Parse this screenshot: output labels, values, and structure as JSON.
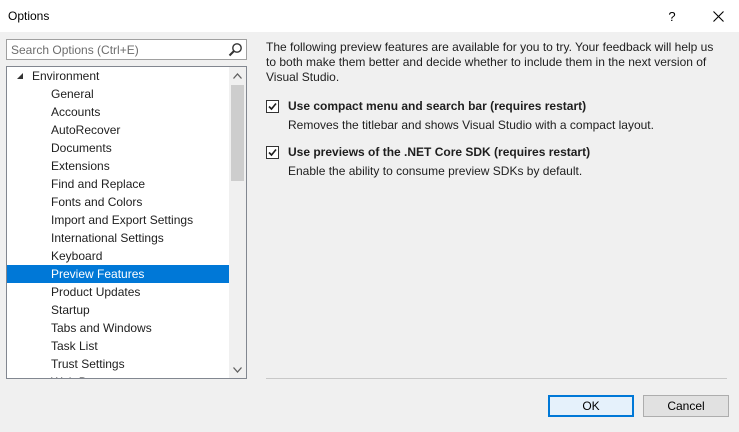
{
  "window": {
    "title": "Options",
    "help_label": "?",
    "close_label": "✕"
  },
  "search": {
    "placeholder": "Search Options (Ctrl+E)",
    "value": ""
  },
  "tree": {
    "root": {
      "label": "Environment",
      "expander": "◢"
    },
    "items": [
      {
        "label": "General"
      },
      {
        "label": "Accounts"
      },
      {
        "label": "AutoRecover"
      },
      {
        "label": "Documents"
      },
      {
        "label": "Extensions"
      },
      {
        "label": "Find and Replace"
      },
      {
        "label": "Fonts and Colors"
      },
      {
        "label": "Import and Export Settings"
      },
      {
        "label": "International Settings"
      },
      {
        "label": "Keyboard"
      },
      {
        "label": "Preview Features",
        "selected": true
      },
      {
        "label": "Product Updates"
      },
      {
        "label": "Startup"
      },
      {
        "label": "Tabs and Windows"
      },
      {
        "label": "Task List"
      },
      {
        "label": "Trust Settings"
      },
      {
        "label": "Web Browser"
      }
    ],
    "scroll_up": "▲",
    "scroll_down": "▼"
  },
  "main": {
    "description": "The following preview features are available for you to try. Your feedback will help us to both make them better and decide whether to include them in the next version of Visual Studio.",
    "options": [
      {
        "label": "Use compact menu and search bar (requires restart)",
        "sublabel": "Removes the titlebar and shows Visual Studio with a compact layout.",
        "checked": true
      },
      {
        "label": "Use previews of the .NET Core SDK (requires restart)",
        "sublabel": "Enable the ability to consume preview SDKs by default.",
        "checked": true
      }
    ]
  },
  "buttons": {
    "ok": "OK",
    "cancel": "Cancel"
  },
  "colors": {
    "selection": "#0078d7",
    "background": "#f0f0f0"
  }
}
